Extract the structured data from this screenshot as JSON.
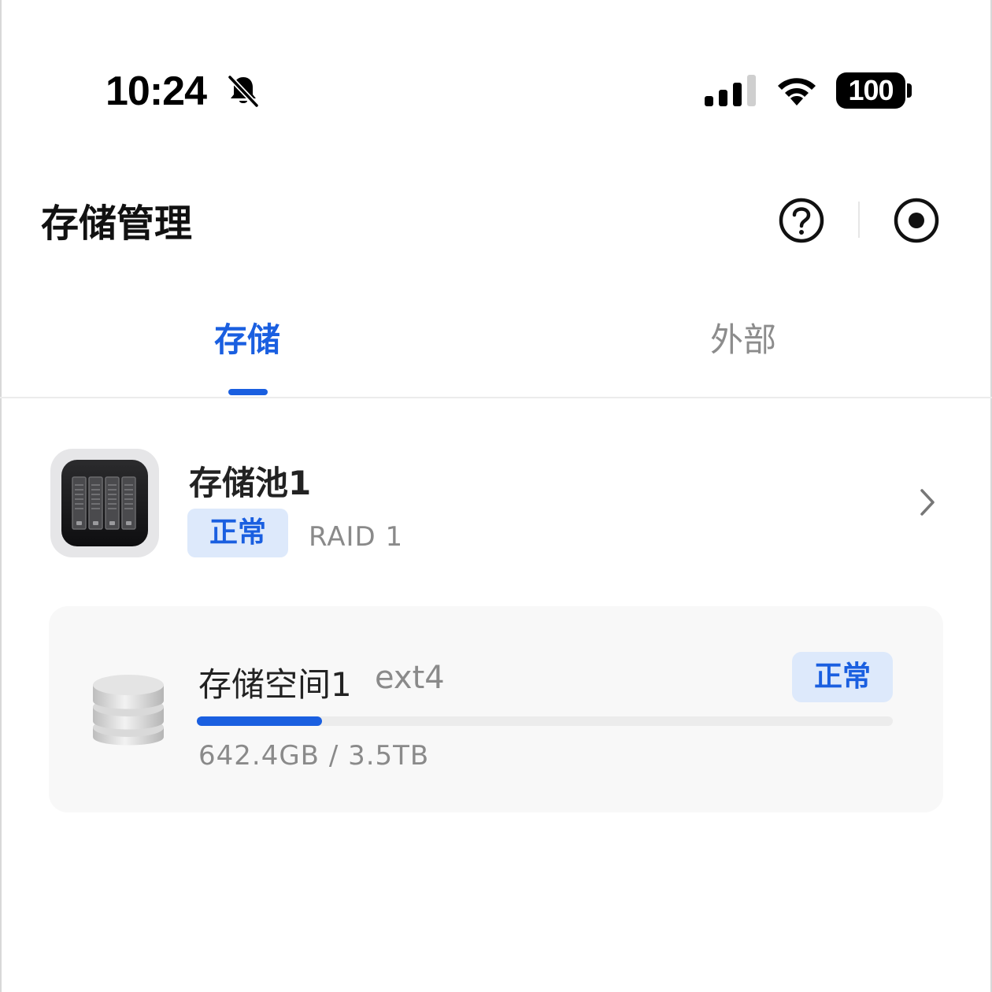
{
  "status_bar": {
    "time": "10:24",
    "battery": "100",
    "icons": [
      "bell-slash-icon",
      "cellular-signal-icon",
      "wifi-icon",
      "battery-icon"
    ]
  },
  "header": {
    "title": "存储管理",
    "icons": [
      "help-icon",
      "record-icon"
    ]
  },
  "tabs": [
    {
      "label": "存储",
      "active": true
    },
    {
      "label": "外部",
      "active": false
    }
  ],
  "pool": {
    "name": "存储池1",
    "status": "正常",
    "raid": "RAID 1",
    "icon": "nas-drive-icon"
  },
  "volume": {
    "name": "存储空间1",
    "filesystem": "ext4",
    "status": "正常",
    "usage_text": "642.4GB / 3.5TB",
    "usage_fraction": 0.18,
    "icon": "database-icon"
  },
  "colors": {
    "accent": "#1a5fe0",
    "badge_bg": "#dde9fb",
    "muted_text": "#8a8a8a",
    "card_bg": "#f8f8f8"
  }
}
